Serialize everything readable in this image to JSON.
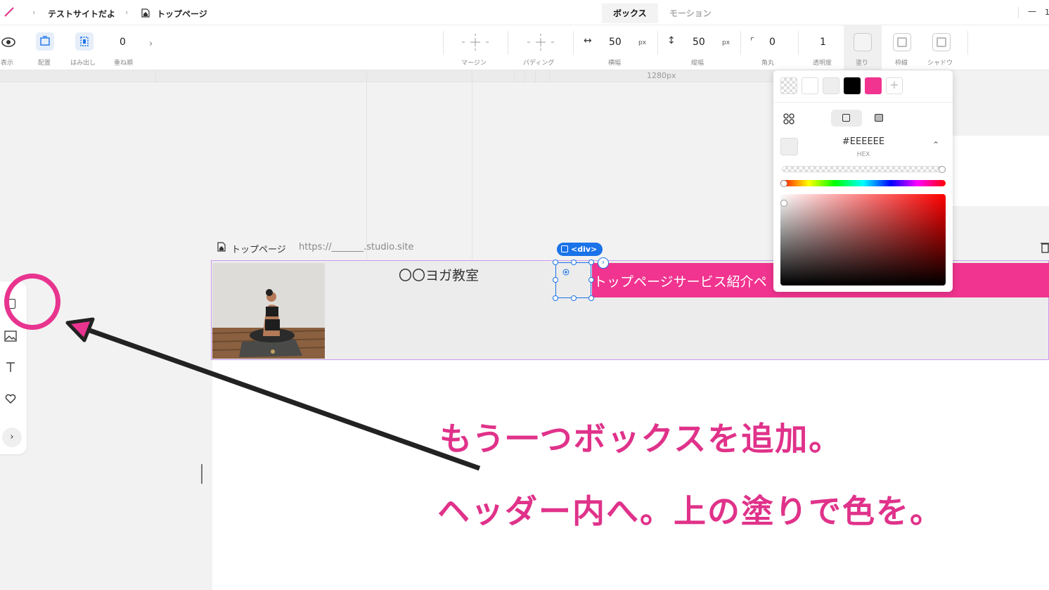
{
  "breadcrumb": {
    "project": "テストサイトだよ",
    "page": "トップページ"
  },
  "tabs": {
    "box": "ボックス",
    "motion": "モーション"
  },
  "window": {
    "minimize": "—",
    "zoom_truncated": "1"
  },
  "toolbar": {
    "display_label": "表示",
    "align_label": "配置",
    "overflow_label": "はみ出し",
    "zindex_value": "0",
    "zindex_label": "重ね順",
    "margin_label": "マージン",
    "padding_label": "パディング",
    "width_value": "50",
    "width_unit": "px",
    "width_label": "横幅",
    "height_value": "50",
    "height_unit": "px",
    "height_label": "縦幅",
    "radius_value": "0",
    "radius_label": "角丸",
    "opacity_value": "1",
    "opacity_label": "透明度",
    "fill_label": "塗り",
    "border_label": "枠線",
    "shadow_label": "シャドウ"
  },
  "ruler": {
    "width_label": "1280px"
  },
  "canvas": {
    "page_name": "トップページ",
    "page_url": "https://_______.studio.site",
    "site_title": "〇〇ヨガ教室",
    "nav_text": "トップページサービス紹介ペ",
    "selected_tag": "<div>"
  },
  "color_picker": {
    "swatches": [
      "transparent",
      "#FFFFFF",
      "#EEEEEE",
      "#000000",
      "#F0348F"
    ],
    "hex_value": "#EEEEEE",
    "hex_label": "HEX",
    "hue": 0,
    "alpha": 1
  },
  "annotations": {
    "line1": "もう一つボックスを追加。",
    "line2": "ヘッダー内へ。上の塗りで色を。",
    "highlight_color": "#E8348F"
  },
  "colors": {
    "accent_blue": "#1A73E8",
    "nav_pink": "#F0348F",
    "header_bg": "#ECECEC"
  }
}
